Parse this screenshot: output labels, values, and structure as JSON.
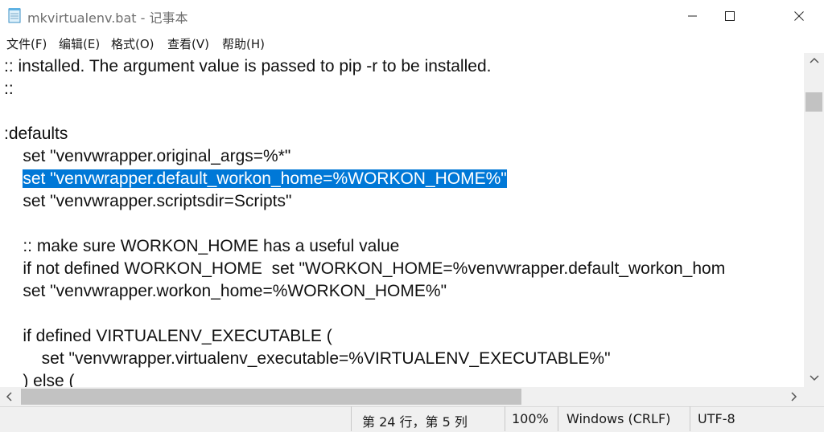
{
  "window": {
    "title": "mkvirtualenv.bat - 记事本",
    "minimize_icon": "minimize-icon",
    "maximize_icon": "maximize-icon",
    "close_icon": "close-icon"
  },
  "menu": [
    "文件(F)",
    "编辑(E)",
    "格式(O)",
    "查看(V)",
    "帮助(H)"
  ],
  "editor": {
    "lines": [
      ":: installed. The argument value is passed to pip -r to be installed.",
      "::",
      "",
      ":defaults",
      "    set \"venvwrapper.original_args=%*\"",
      "set \"venvwrapper.default_workon_home=%WORKON_HOME%\"",
      "    set \"venvwrapper.scriptsdir=Scripts\"",
      "",
      "    :: make sure WORKON_HOME has a useful value",
      "    if not defined WORKON_HOME  set \"WORKON_HOME=%venvwrapper.default_workon_hom",
      "    set \"venvwrapper.workon_home=%WORKON_HOME%\"",
      "",
      "    if defined VIRTUALENV_EXECUTABLE (",
      "        set \"venvwrapper.virtualenv_executable=%VIRTUALENV_EXECUTABLE%\"",
      "    ) else ("
    ],
    "selection_indent": "    ",
    "selection_line_index": 5,
    "selection_color": "#0078d7"
  },
  "statusbar": {
    "position": "第 24 行，第 5 列",
    "zoom": "100%",
    "line_ending": "Windows (CRLF)",
    "encoding": "UTF-8"
  }
}
